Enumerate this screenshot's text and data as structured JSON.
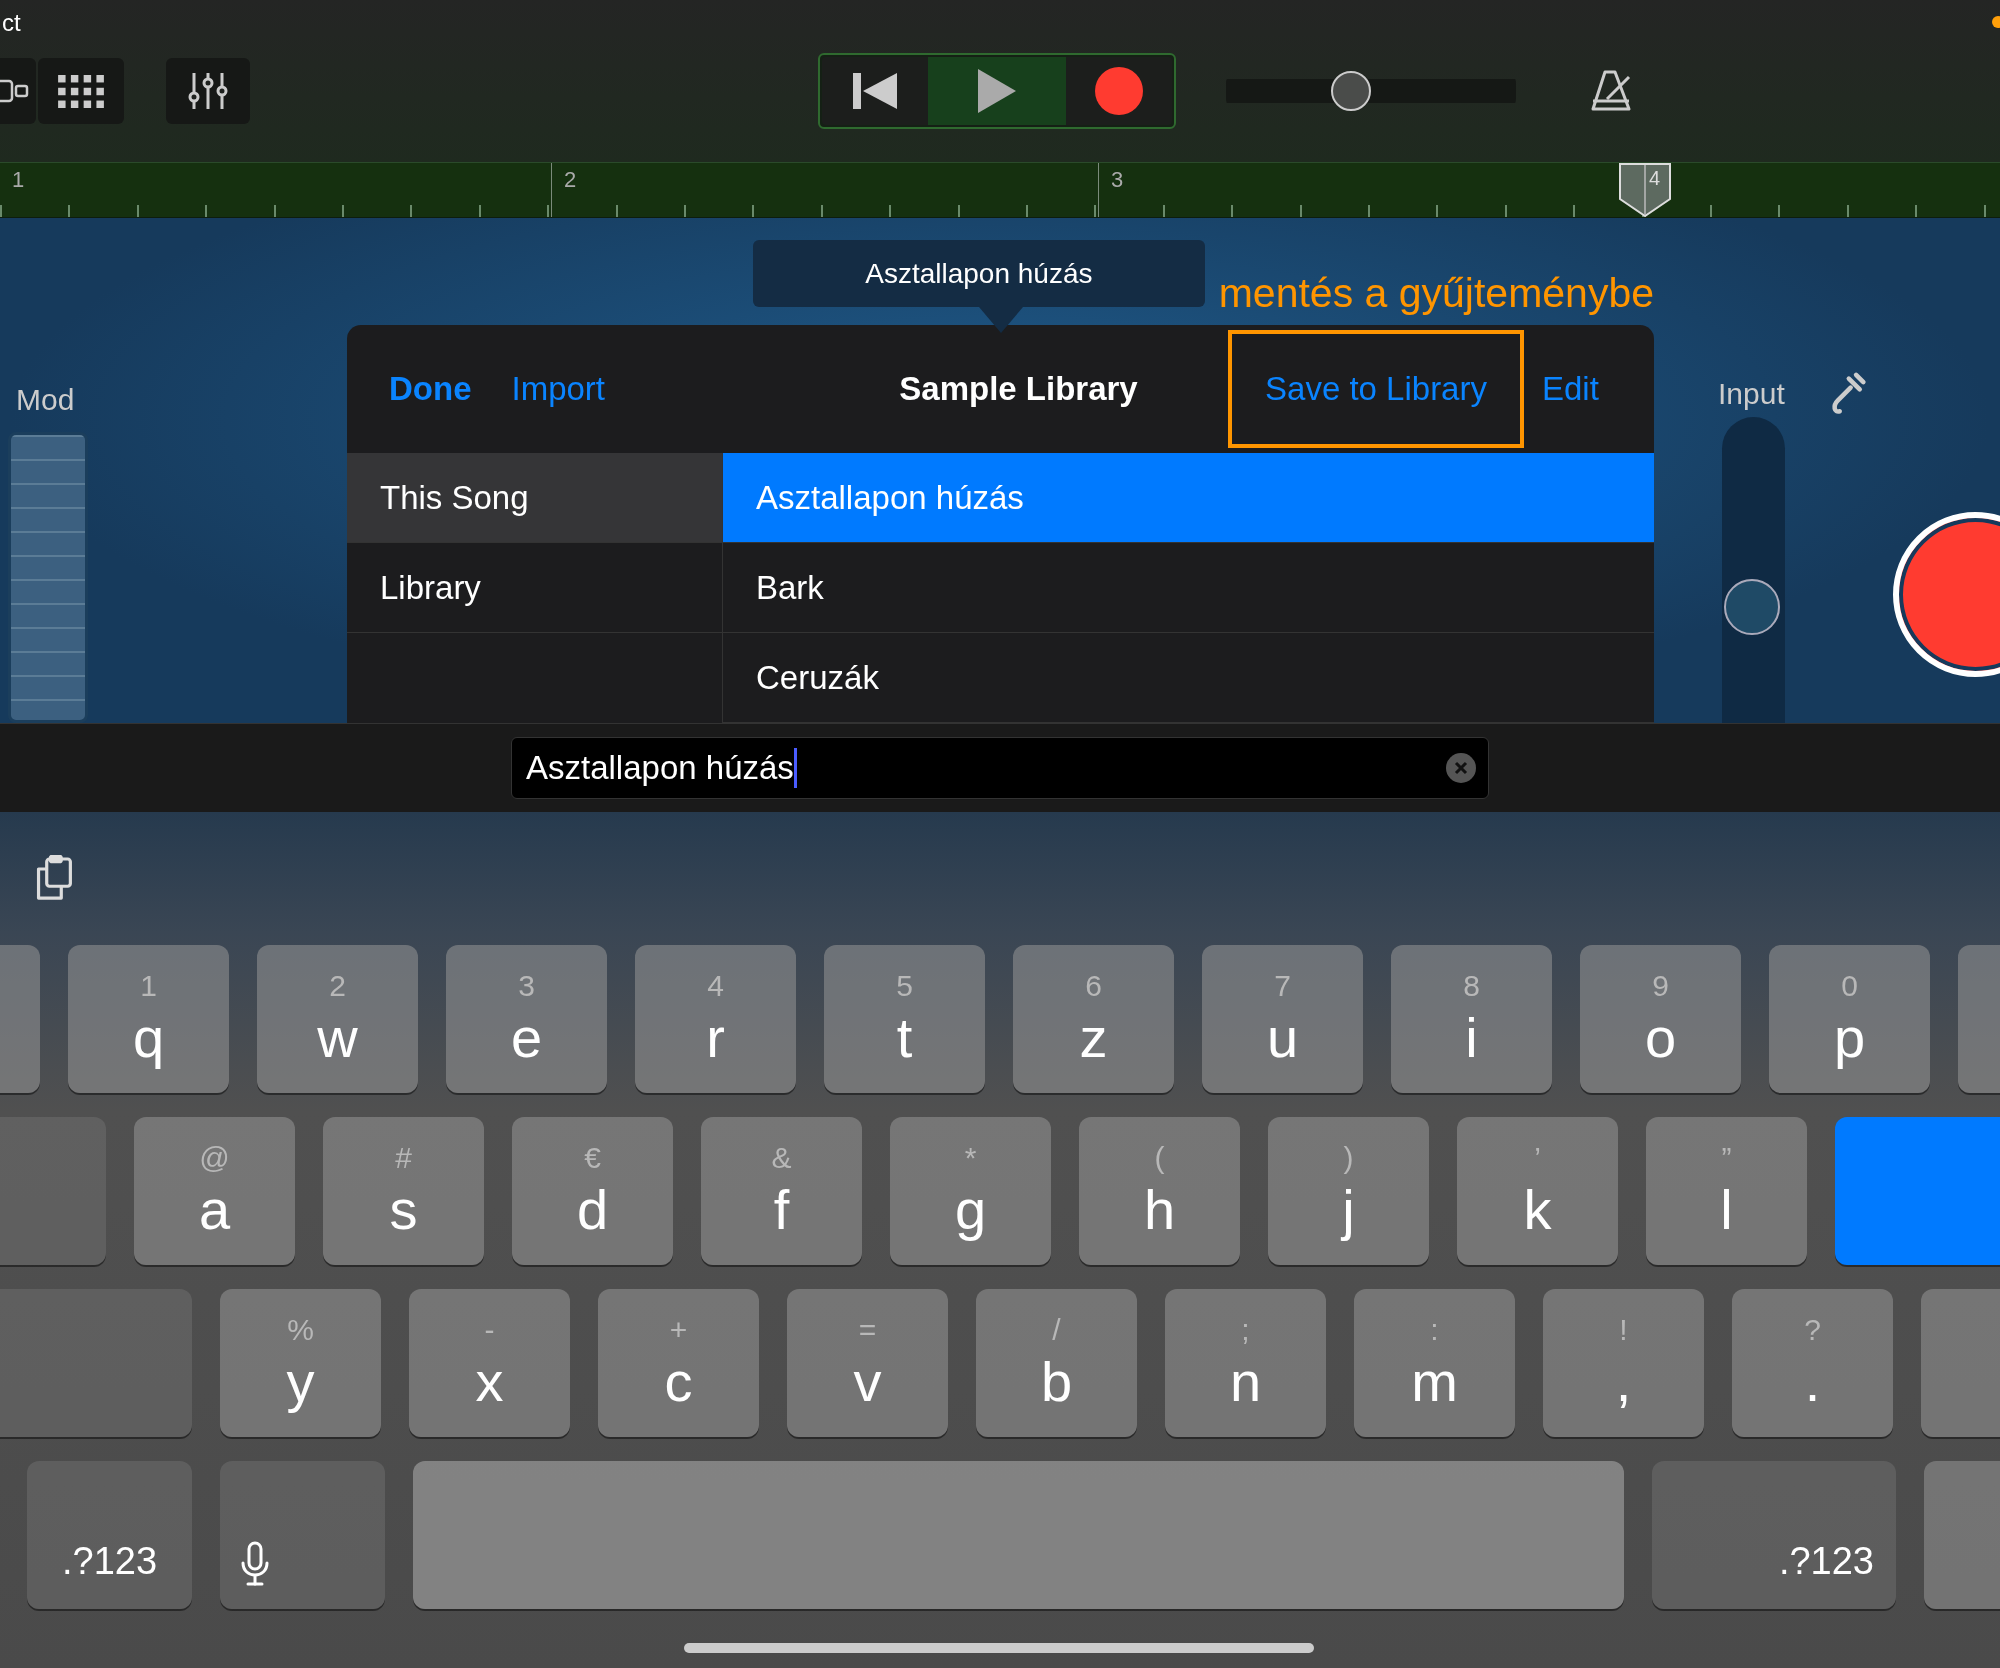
{
  "status_bar": {
    "time": "ct"
  },
  "toolbar": {
    "volume": {
      "level": 0.43
    }
  },
  "ruler": {
    "bars": [
      {
        "label": "1",
        "playhead": false
      },
      {
        "label": "2",
        "playhead": false
      },
      {
        "label": "3",
        "playhead": false
      },
      {
        "label": "4",
        "playhead": true
      }
    ]
  },
  "mod": {
    "label": "Mod"
  },
  "input": {
    "label": "Input",
    "level": 0.5
  },
  "tooltip": "Asztallapon húzás",
  "annotation": "mentés a gyűjteménybe",
  "popover": {
    "left_buttons": [
      "Done",
      "Import"
    ],
    "title": "Sample Library",
    "save_button": "Save to Library",
    "edit_button": "Edit",
    "sidebar": [
      {
        "label": "This Song",
        "selected": true
      },
      {
        "label": "Library",
        "selected": false
      }
    ],
    "items": [
      {
        "label": "Asztallapon húzás",
        "selected": true
      },
      {
        "label": "Bark",
        "selected": false
      },
      {
        "label": "Ceruzák",
        "selected": false
      }
    ]
  },
  "text_field": {
    "value": "Asztallapon húzás"
  },
  "keyboard": {
    "rows": [
      {
        "keys": [
          {
            "kind": "partial"
          },
          {
            "kind": "letter",
            "main": "q",
            "alt": "1"
          },
          {
            "kind": "letter",
            "main": "w",
            "alt": "2"
          },
          {
            "kind": "letter",
            "main": "e",
            "alt": "3"
          },
          {
            "kind": "letter",
            "main": "r",
            "alt": "4"
          },
          {
            "kind": "letter",
            "main": "t",
            "alt": "5"
          },
          {
            "kind": "letter",
            "main": "z",
            "alt": "6"
          },
          {
            "kind": "letter",
            "main": "u",
            "alt": "7"
          },
          {
            "kind": "letter",
            "main": "i",
            "alt": "8"
          },
          {
            "kind": "letter",
            "main": "o",
            "alt": "9"
          },
          {
            "kind": "letter",
            "main": "p",
            "alt": "0"
          },
          {
            "kind": "edge"
          }
        ]
      },
      {
        "keys": [
          {
            "kind": "caps"
          },
          {
            "kind": "letter",
            "main": "a",
            "alt": "@"
          },
          {
            "kind": "letter",
            "main": "s",
            "alt": "#"
          },
          {
            "kind": "letter",
            "main": "d",
            "alt": "€"
          },
          {
            "kind": "letter",
            "main": "f",
            "alt": "&"
          },
          {
            "kind": "letter",
            "main": "g",
            "alt": "*"
          },
          {
            "kind": "letter",
            "main": "h",
            "alt": "("
          },
          {
            "kind": "letter",
            "main": "j",
            "alt": ")"
          },
          {
            "kind": "letter",
            "main": "k",
            "alt": "’"
          },
          {
            "kind": "letter",
            "main": "l",
            "alt": "”"
          },
          {
            "kind": "return"
          }
        ]
      },
      {
        "keys": [
          {
            "kind": "shift"
          },
          {
            "kind": "letter",
            "main": "y",
            "alt": "%"
          },
          {
            "kind": "letter",
            "main": "x",
            "alt": "-"
          },
          {
            "kind": "letter",
            "main": "c",
            "alt": "+"
          },
          {
            "kind": "letter",
            "main": "v",
            "alt": "="
          },
          {
            "kind": "letter",
            "main": "b",
            "alt": "/"
          },
          {
            "kind": "letter",
            "main": "n",
            "alt": ";"
          },
          {
            "kind": "letter",
            "main": "m",
            "alt": ":"
          },
          {
            "kind": "letter",
            "main": ",",
            "alt": "!"
          },
          {
            "kind": "letter",
            "main": ".",
            "alt": "?"
          },
          {
            "kind": "edge"
          }
        ]
      },
      {
        "keys": [
          {
            "kind": "symbols",
            "label": ".?123"
          },
          {
            "kind": "mic"
          },
          {
            "kind": "space"
          },
          {
            "kind": "symbols",
            "label": ".?123"
          },
          {
            "kind": "edge"
          }
        ]
      }
    ]
  }
}
